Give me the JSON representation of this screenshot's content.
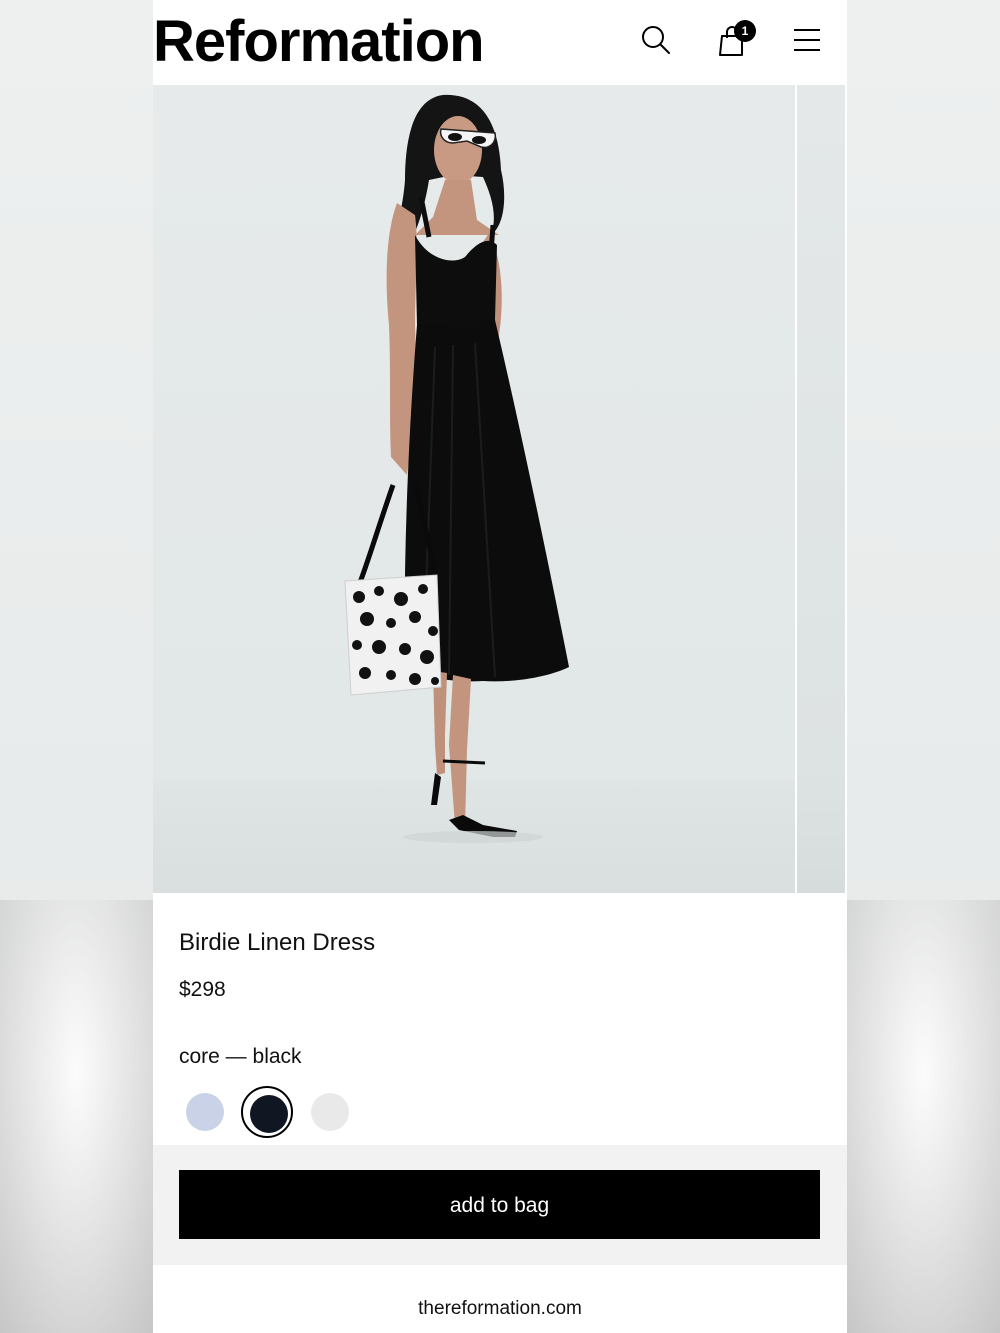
{
  "header": {
    "logo": "Reformation",
    "bag_count": "1",
    "icons": [
      "search-icon",
      "shopping-bag-icon",
      "hamburger-menu-icon"
    ]
  },
  "product": {
    "name": "Birdie Linen Dress",
    "price": "$298",
    "color_label": "core — black",
    "swatches": [
      {
        "color": "#c9d2e6",
        "selected": false
      },
      {
        "color": "#111623",
        "selected": true
      },
      {
        "color": "#e9e9e9",
        "selected": false
      }
    ]
  },
  "cta": {
    "add_to_bag": "add to bag"
  },
  "browser": {
    "url": "thereformation.com"
  }
}
